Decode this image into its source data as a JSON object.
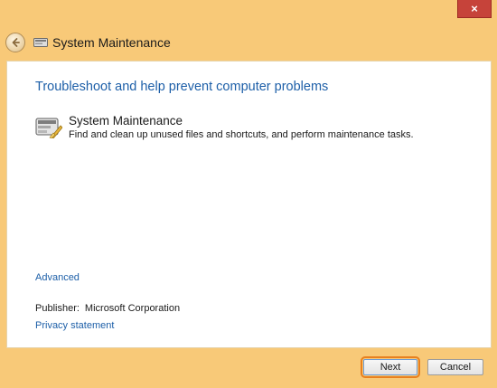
{
  "window": {
    "title": "System Maintenance",
    "close_label": "×"
  },
  "main": {
    "heading": "Troubleshoot and help prevent computer problems",
    "task": {
      "title": "System Maintenance",
      "description": "Find and clean up unused files and shortcuts, and perform maintenance tasks."
    },
    "advanced_link": "Advanced",
    "publisher_label": "Publisher:",
    "publisher_value": "Microsoft Corporation",
    "privacy_link": "Privacy statement"
  },
  "footer": {
    "next_label": "Next",
    "cancel_label": "Cancel"
  },
  "icons": {
    "back": "back-arrow-icon",
    "title": "system-maintenance-icon",
    "task": "system-maintenance-icon",
    "close": "close-icon"
  },
  "colors": {
    "frame": "#f8c978",
    "link": "#1d5fa8",
    "close_button": "#c6433a",
    "focus_outline": "#e8801f"
  }
}
